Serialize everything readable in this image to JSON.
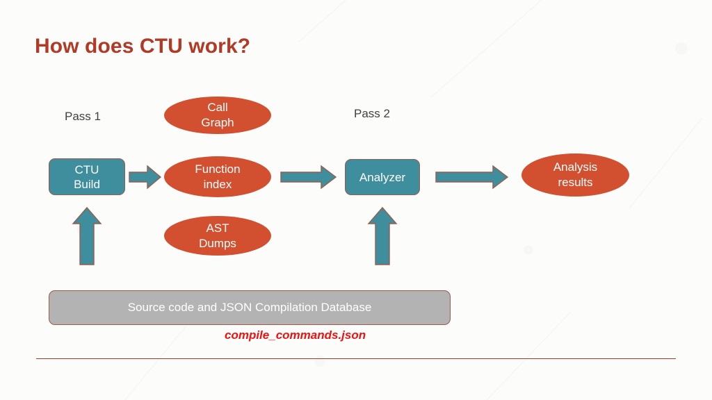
{
  "slide": {
    "title": "How does CTU work?",
    "title_color": "#b03a26",
    "background_color": "#fcfcfb",
    "divider_color": "#9c3a2c"
  },
  "theme": {
    "teal": "#3e8e9e",
    "orange": "#d2502f",
    "gray": "#b3b3b3",
    "shape_border": "#9c5a4a",
    "accent_red": "#ee1111",
    "label_gray": "#404040"
  },
  "labels": {
    "pass1": "Pass 1",
    "pass2": "Pass 2"
  },
  "boxes": {
    "ctu_build": "CTU\nBuild",
    "ctu_build_line1": "CTU",
    "ctu_build_line2": "Build",
    "analyzer": "Analyzer"
  },
  "ellipses": {
    "call_graph_line1": "Call",
    "call_graph_line2": "Graph",
    "function_index_line1": "Function",
    "function_index_line2": "index",
    "ast_dumps_line1": "AST",
    "ast_dumps_line2": "Dumps",
    "analysis_results_line1": "Analysis",
    "analysis_results_line2": "results"
  },
  "source_bar": {
    "text": "Source code and JSON Compilation Database"
  },
  "footnote": {
    "compile_commands": "compile_commands.json"
  },
  "icons": {
    "arrow_right": "arrow-right-icon",
    "arrow_up": "arrow-up-icon"
  },
  "flow": {
    "description": "CTU two-pass workflow diagram",
    "nodes": [
      {
        "id": "ctu-build",
        "label": "CTU Build",
        "shape": "rounded-rect",
        "color": "#3e8e9e",
        "pass": "Pass 1"
      },
      {
        "id": "call-graph",
        "label": "Call Graph",
        "shape": "ellipse",
        "color": "#d2502f",
        "pass": "Pass 1"
      },
      {
        "id": "function-index",
        "label": "Function index",
        "shape": "ellipse",
        "color": "#d2502f",
        "pass": "Pass 1"
      },
      {
        "id": "ast-dumps",
        "label": "AST Dumps",
        "shape": "ellipse",
        "color": "#d2502f",
        "pass": "Pass 1"
      },
      {
        "id": "analyzer",
        "label": "Analyzer",
        "shape": "rounded-rect",
        "color": "#3e8e9e",
        "pass": "Pass 2"
      },
      {
        "id": "analysis-results",
        "label": "Analysis results",
        "shape": "ellipse",
        "color": "#d2502f",
        "pass": "Pass 2"
      },
      {
        "id": "source-db",
        "label": "Source code and JSON Compilation Database",
        "shape": "rounded-rect",
        "color": "#b3b3b3",
        "pass": ""
      }
    ],
    "edges": [
      {
        "from": "ctu-build",
        "to": "function-index",
        "direction": "right"
      },
      {
        "from": "function-index",
        "to": "analyzer",
        "direction": "right"
      },
      {
        "from": "analyzer",
        "to": "analysis-results",
        "direction": "right"
      },
      {
        "from": "source-db",
        "to": "ctu-build",
        "direction": "up"
      },
      {
        "from": "source-db",
        "to": "analyzer",
        "direction": "up"
      }
    ]
  }
}
